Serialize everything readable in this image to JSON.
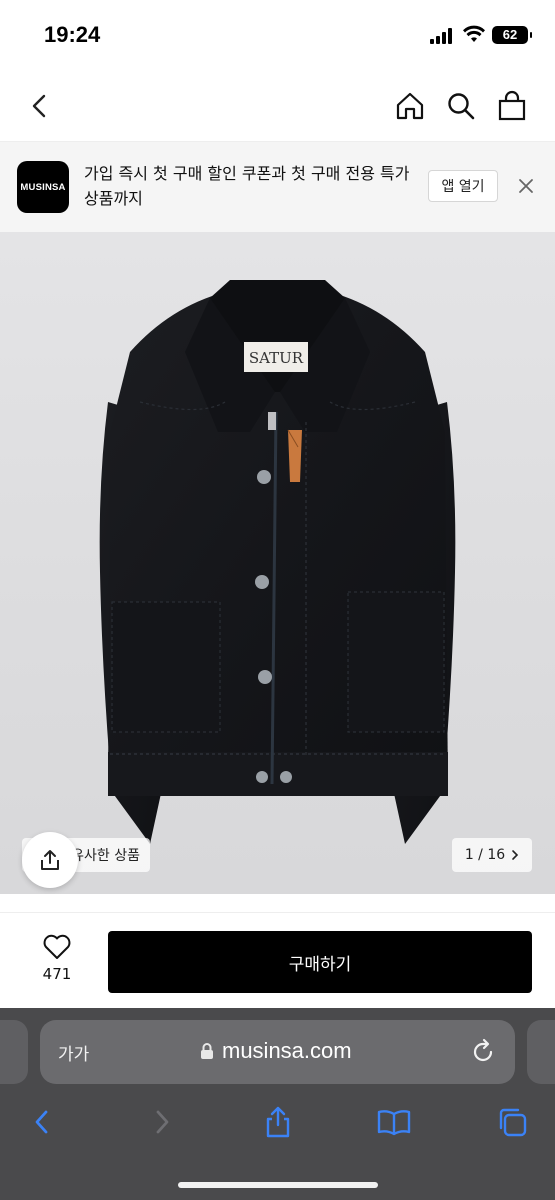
{
  "status_bar": {
    "time": "19:24",
    "battery": "62"
  },
  "nav": {
    "back_icon": "chevron-left-icon",
    "home_icon": "home-icon",
    "search_icon": "search-icon",
    "cart_icon": "shopping-bag-icon"
  },
  "app_banner": {
    "logo_text": "MUSINSA",
    "message": "가입 즉시 첫 구매 할인 쿠폰과 첫 구매 전용 특가 상품까지",
    "open_app_label": "앱 열기",
    "close_icon": "close-icon"
  },
  "product": {
    "brand_label_text": "SATUR",
    "similar_label": "유사한 상품",
    "page_indicator": "1 / 16",
    "share_icon": "share-icon"
  },
  "actions": {
    "like_count": "471",
    "buy_label": "구매하기"
  },
  "safari": {
    "aa_label": "가가",
    "url": "musinsa.com",
    "colors": {
      "toolbar_bg": "#4a4a4c",
      "accent": "#3b82f6"
    }
  }
}
